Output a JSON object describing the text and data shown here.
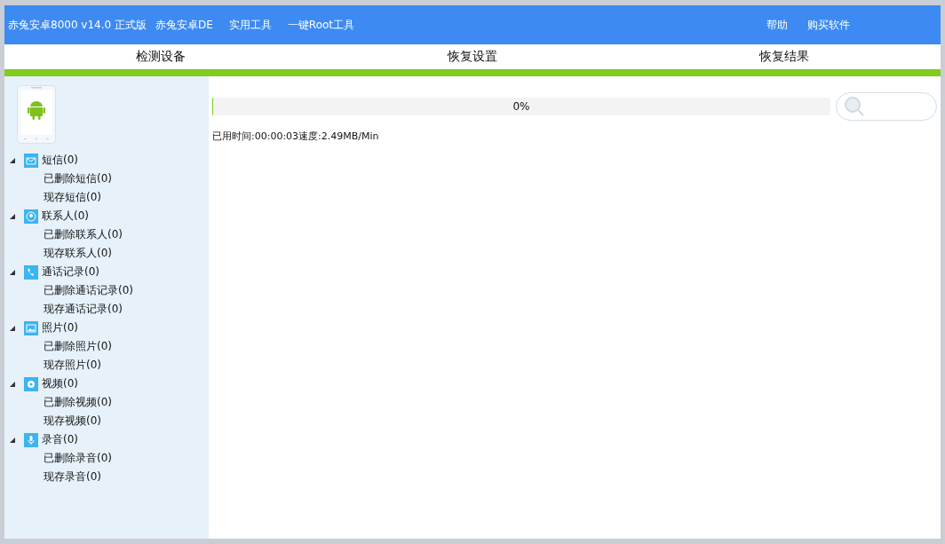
{
  "header": {
    "title": "赤兔安卓8000 v14.0 正式版",
    "menu_left": [
      "赤兔安卓DE",
      "实用工具",
      "一键Root工具"
    ],
    "menu_right": [
      "帮助",
      "购买软件"
    ]
  },
  "steps": [
    "检测设备",
    "恢复设置",
    "恢复结果"
  ],
  "tree": [
    {
      "kind": "message",
      "label": "短信(0)",
      "expanded": true,
      "children": [
        {
          "label": "已删除短信(0)"
        },
        {
          "label": "现存短信(0)"
        }
      ]
    },
    {
      "kind": "contact",
      "label": "联系人(0)",
      "expanded": true,
      "children": [
        {
          "label": "已删除联系人(0)"
        },
        {
          "label": "现存联系人(0)"
        }
      ]
    },
    {
      "kind": "call",
      "label": "通话记录(0)",
      "expanded": true,
      "children": [
        {
          "label": "已删除通话记录(0)"
        },
        {
          "label": "现存通话记录(0)"
        }
      ]
    },
    {
      "kind": "photo",
      "label": "照片(0)",
      "expanded": true,
      "children": [
        {
          "label": "已删除照片(0)"
        },
        {
          "label": "现存照片(0)"
        }
      ]
    },
    {
      "kind": "video",
      "label": "视频(0)",
      "expanded": true,
      "children": [
        {
          "label": "已删除视频(0)"
        },
        {
          "label": "现存视频(0)"
        }
      ]
    },
    {
      "kind": "audio",
      "label": "录音(0)",
      "expanded": true,
      "children": [
        {
          "label": "已删除录音(0)"
        },
        {
          "label": "现存录音(0)"
        }
      ]
    }
  ],
  "progress": {
    "level": 0,
    "reading": "0%"
  },
  "status": "已用时间:00:00:03速度:2.49MB/Min"
}
